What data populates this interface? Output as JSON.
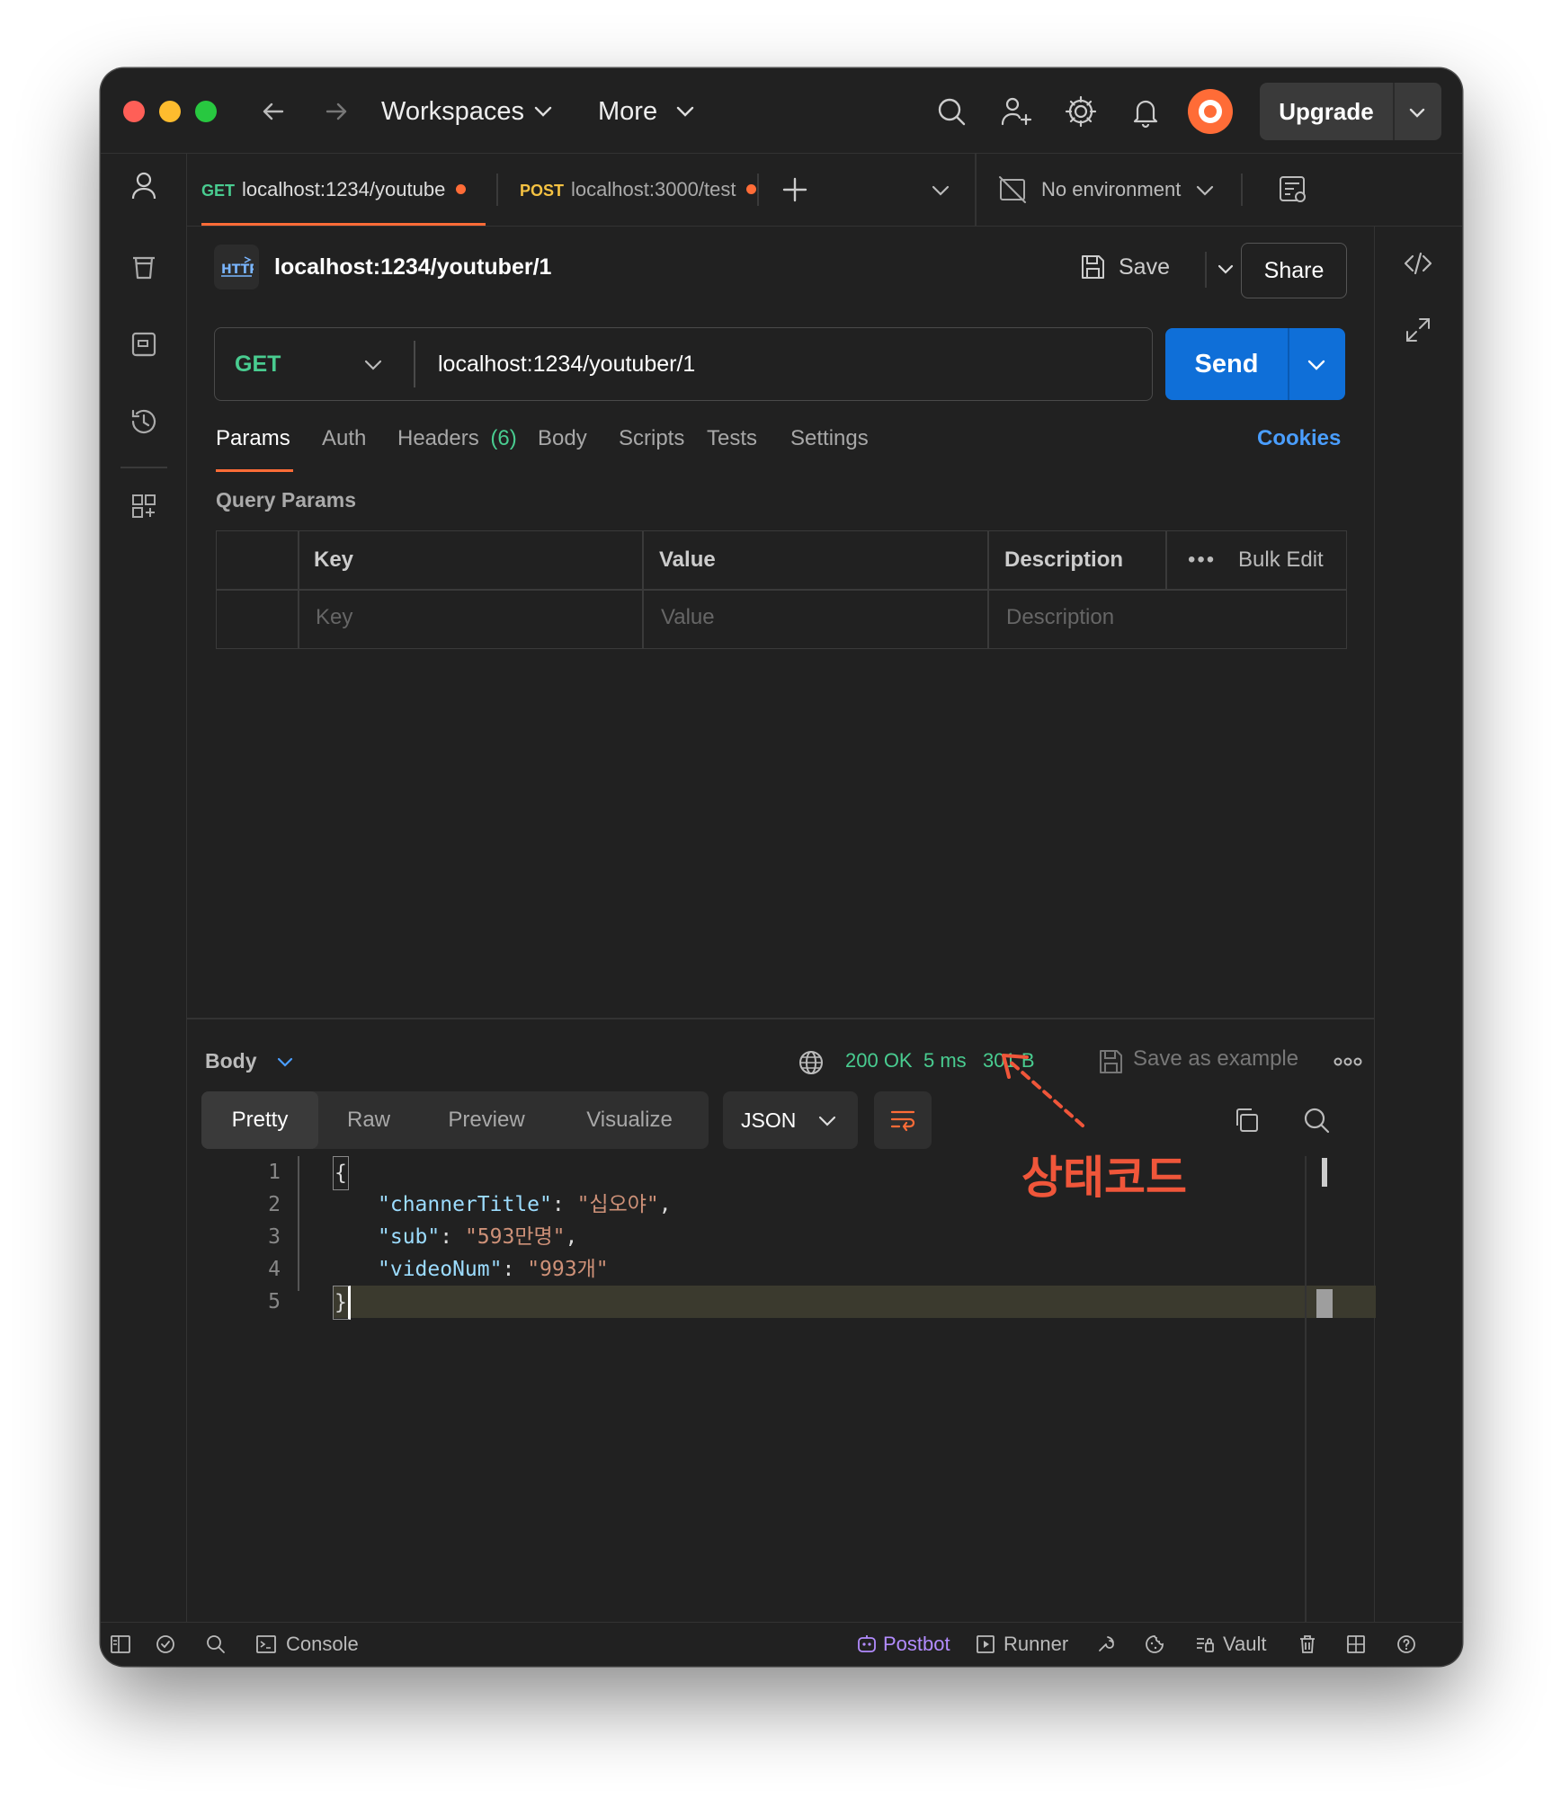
{
  "window": {
    "traffic_lights": [
      "#ff5f57",
      "#febc2e",
      "#28c840"
    ]
  },
  "titlebar": {
    "workspaces_label": "Workspaces",
    "more_label": "More",
    "upgrade_label": "Upgrade"
  },
  "tabs": [
    {
      "method": "GET",
      "method_color": "#49cc90",
      "url": "localhost:1234/youtube",
      "unsaved": true,
      "active": true
    },
    {
      "method": "POST",
      "method_color": "#f5c242",
      "url": "localhost:3000/test",
      "unsaved": true,
      "active": false
    }
  ],
  "environment": {
    "label": "No environment"
  },
  "request": {
    "title": "localhost:1234/youtuber/1",
    "save_label": "Save",
    "share_label": "Share",
    "method": "GET",
    "url": "localhost:1234/youtuber/1",
    "send_label": "Send"
  },
  "request_tabs": {
    "params": "Params",
    "auth": "Auth",
    "headers": "Headers",
    "headers_count": "(6)",
    "body": "Body",
    "scripts": "Scripts",
    "tests": "Tests",
    "settings": "Settings",
    "cookies": "Cookies"
  },
  "query_params": {
    "title": "Query Params",
    "headers": {
      "key": "Key",
      "value": "Value",
      "description": "Description",
      "bulk_edit": "Bulk Edit"
    },
    "placeholders": {
      "key": "Key",
      "value": "Value",
      "description": "Description"
    }
  },
  "response": {
    "body_label": "Body",
    "status": "200 OK",
    "time": "5 ms",
    "size": "301 B",
    "save_example": "Save as example",
    "view_tabs": {
      "pretty": "Pretty",
      "raw": "Raw",
      "preview": "Preview",
      "visualize": "Visualize"
    },
    "format": "JSON",
    "lines": [
      {
        "num": "1",
        "open": "{"
      },
      {
        "num": "2",
        "key": "\"channerTitle\"",
        "value": "\"십오야\"",
        "comma": ","
      },
      {
        "num": "3",
        "key": "\"sub\"",
        "value": "\"593만명\"",
        "comma": ","
      },
      {
        "num": "4",
        "key": "\"videoNum\"",
        "value": "\"993개\"",
        "comma": ""
      },
      {
        "num": "5",
        "close": "}"
      }
    ]
  },
  "annotation": {
    "text": "상태코드",
    "color": "#f0563a"
  },
  "footer": {
    "console": "Console",
    "postbot": "Postbot",
    "runner": "Runner",
    "vault": "Vault"
  },
  "colors": {
    "accent": "#ff6c37",
    "send": "#0f6fd8",
    "success": "#49cc90",
    "link": "#4a9eff",
    "postbot": "#b38cff"
  }
}
